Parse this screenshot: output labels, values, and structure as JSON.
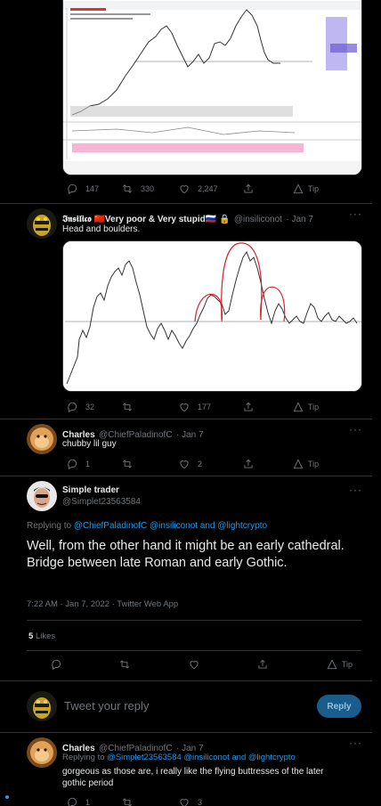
{
  "top_media": {
    "alt": "",
    "action_counts": {
      "reply": "147",
      "retweet": "330",
      "like": "2,247",
      "tip": "Tip"
    }
  },
  "tweet_insilico": {
    "name": "𝕴𝖓𝖘𝖎𝖑𝖎𝖈𝖔 🇨🇳Very poor & Very stupid🇷🇺 🔒",
    "handle": "@insiliconot",
    "date": "· Jan 7",
    "text": "Head and boulders.",
    "counts": {
      "reply": "32",
      "retweet": "",
      "like": "177",
      "tip": "Tip"
    }
  },
  "tweet_charles1": {
    "name": "Charles",
    "handle": "@ChiefPaladinofC",
    "date": "· Jan 7",
    "text": "chubby lil guy",
    "counts": {
      "reply": "1",
      "retweet": "",
      "like": "2",
      "tip": "Tip"
    }
  },
  "tweet_main": {
    "name": "Simple trader",
    "handle": "@Simplet23563584",
    "replying_prefix": "Replying to ",
    "replying_to": "@ChiefPaladinofC @insiliconot and @lightcrypto",
    "text": "Well, from the other hand it might be an early cathedral. Bridge between late Roman and early Gothic.",
    "timestamp": "7:22 AM · Jan 7, 2022 · Twitter Web App",
    "likes_count": "5",
    "likes_label": "Likes",
    "tip": "Tip"
  },
  "compose": {
    "placeholder": "Tweet your reply",
    "button": "Reply"
  },
  "tweet_charles2": {
    "name": "Charles",
    "handle": "@ChiefPaladinofC",
    "date": "· Jan 7",
    "replying_prefix": "Replying to ",
    "replying_to": "@Simplet23563584 @insiliconot and @lightcrypto",
    "text": "gorgeous as those are, i really like the flying buttresses of the later gothic period",
    "counts": {
      "reply": "1",
      "retweet": "",
      "like": "3",
      "tip": ""
    }
  },
  "colors": {
    "accent": "#1d9bf0",
    "muted": "#71767b",
    "bg": "#000000",
    "chart_line": "#333333",
    "annotation": "#e0202a"
  }
}
